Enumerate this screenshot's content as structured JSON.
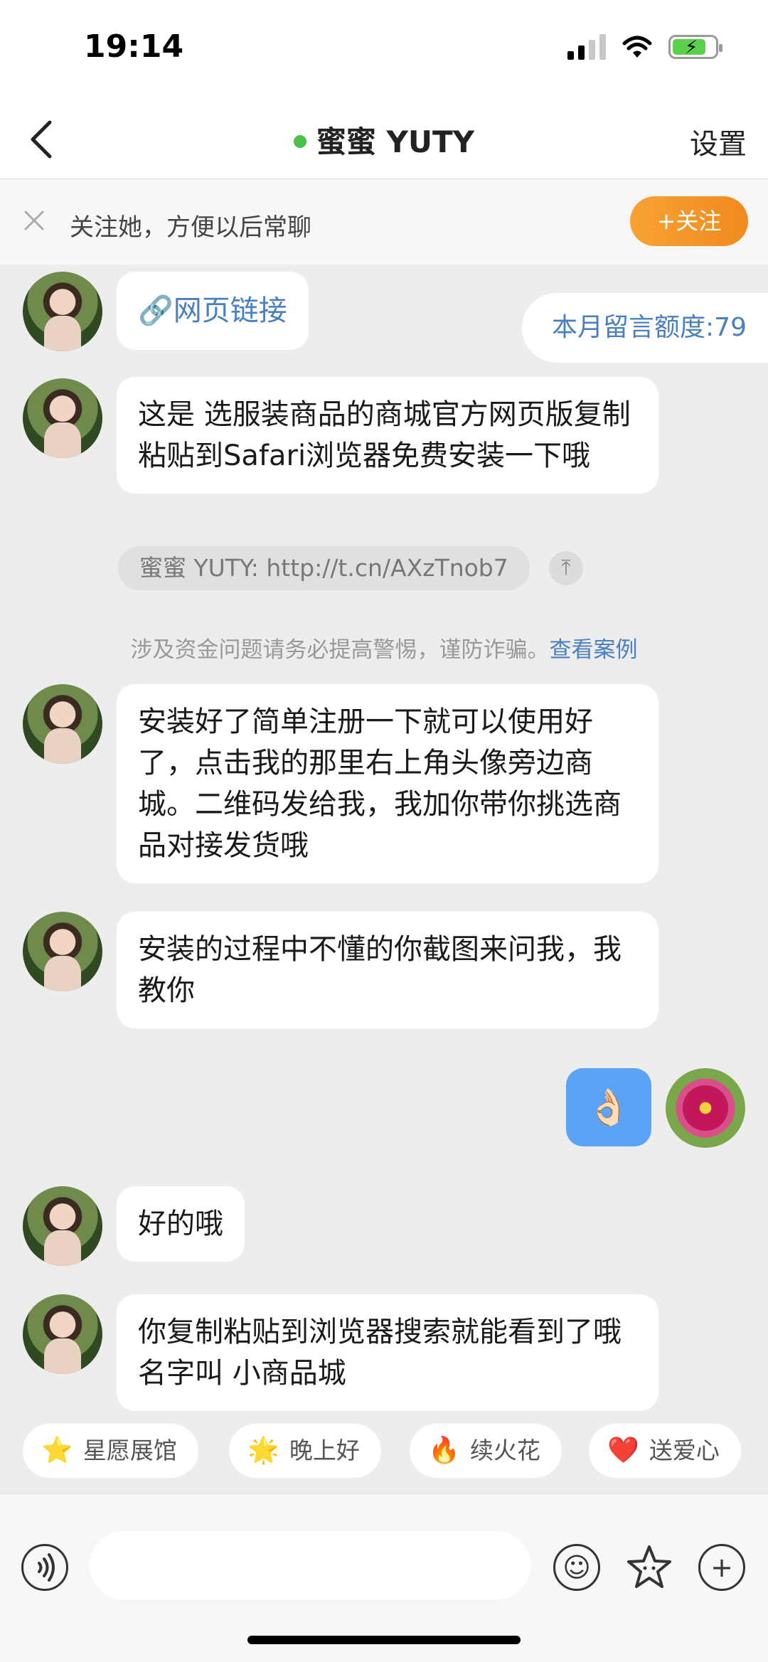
{
  "status_bar": {
    "time": "19:14"
  },
  "header": {
    "title": "蜜蜜 YUTY",
    "settings_label": "设置"
  },
  "follow_bar": {
    "text": "关注她，方便以后常聊",
    "button_label": "+关注"
  },
  "chat": {
    "quota_label": "本月留言额度:79",
    "messages": [
      {
        "text": "🔗网页链接"
      },
      {
        "text": "这是 选服装商品的商城官方网页版复制粘贴到Safari浏览器免费安装一下哦"
      },
      {
        "text": "安装好了简单注册一下就可以使用好了，点击我的那里右上角头像旁边商城。二维码发给我，我加你带你挑选商品对接发货哦"
      },
      {
        "text": "安装的过程中不懂的你截图来问我，我教你"
      },
      {
        "text": "👌🏻"
      },
      {
        "text": "好的哦"
      },
      {
        "text": "你复制粘贴到浏览器搜索就能看到了哦名字叫 小商品城"
      }
    ],
    "quote": "蜜蜜 YUTY: http://t.cn/AXzTnob7",
    "notice_text": "涉及资金问题请务必提高警惕，谨防诈骗。",
    "notice_link": "查看案例"
  },
  "quick_replies": [
    {
      "icon": "⭐",
      "label": "星愿展馆"
    },
    {
      "icon": "🌟",
      "label": "晚上好"
    },
    {
      "icon": "🔥",
      "label": "续火花"
    },
    {
      "icon": "❤️",
      "label": "送爱心"
    }
  ],
  "colors": {
    "accent": "#f18a1f",
    "link": "#4a7fc0",
    "my_bubble": "#5aa3f7",
    "online": "#4cc04a"
  }
}
